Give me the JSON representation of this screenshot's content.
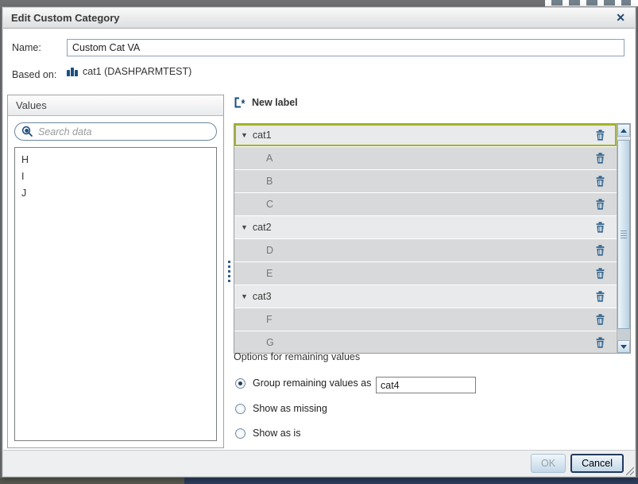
{
  "dialog": {
    "title": "Edit Custom Category",
    "close_glyph": "✕"
  },
  "form": {
    "name_label": "Name:",
    "name_value": "Custom Cat VA",
    "based_on_label": "Based on:",
    "based_on_value": "cat1 (DASHPARMTEST)",
    "based_on_icon": "category-bar-chart-icon"
  },
  "values_panel": {
    "header": "Values",
    "search_placeholder": "Search data",
    "items": [
      "H",
      "I",
      "J"
    ]
  },
  "labels_panel": {
    "new_label_button": "New label",
    "caret_glyph": "▼",
    "rows": [
      {
        "label": "cat1",
        "type": "group",
        "selected": true
      },
      {
        "label": "A",
        "type": "child"
      },
      {
        "label": "B",
        "type": "child"
      },
      {
        "label": "C",
        "type": "child"
      },
      {
        "label": "cat2",
        "type": "group"
      },
      {
        "label": "D",
        "type": "child"
      },
      {
        "label": "E",
        "type": "child"
      },
      {
        "label": "cat3",
        "type": "group"
      },
      {
        "label": "F",
        "type": "child"
      },
      {
        "label": "G",
        "type": "child"
      }
    ]
  },
  "options": {
    "heading": "Options for remaining values",
    "radios": [
      {
        "label": "Group remaining values as",
        "selected": true
      },
      {
        "label": "Show as missing",
        "selected": false
      },
      {
        "label": "Show as is",
        "selected": false
      }
    ],
    "group_value": "cat4"
  },
  "footer": {
    "ok_label": "OK",
    "ok_enabled": false,
    "cancel_label": "Cancel"
  },
  "colors": {
    "selection_green": "#a4b41e",
    "icon_navy": "#2a5d87",
    "dark_navy": "#1d4e7e",
    "group_row_bg": "#e9eaeb",
    "child_row_bg": "#d8d9da",
    "footer_bg": "#edeff0",
    "bottom_strip": "#2c3c59"
  }
}
